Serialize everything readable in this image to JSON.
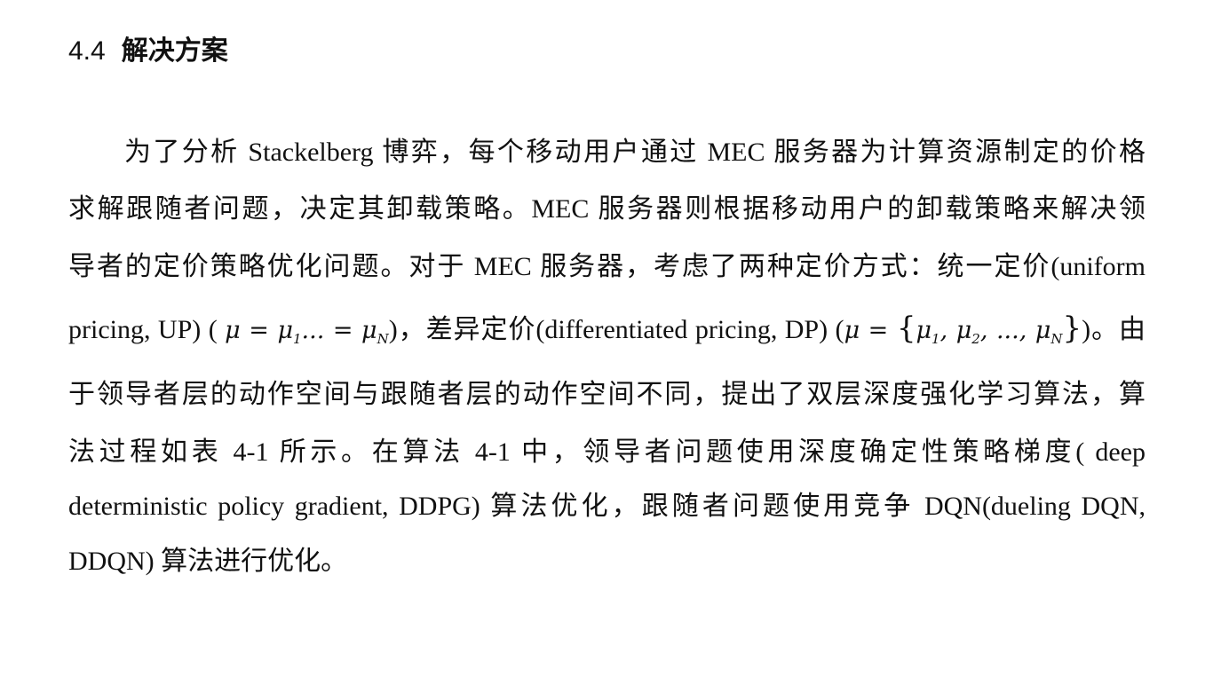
{
  "section": {
    "number": "4.4",
    "title": "解决方案"
  },
  "body": {
    "l1": "为了分析 Stackelberg 博弈，每个移动用户通过 MEC 服务器为计算资源制定的价格",
    "l2": "求解跟随者问题，决定其卸载策略。MEC 服务器则根据移动用户的卸载策略来解决领",
    "l3": "导者的定价策略优化问题。对于 MEC 服务器，考虑了两种定价方式：统一定价(uniform",
    "l4": {
      "a": "pricing, UP) (",
      "b": ")，差异定价(differentiated pricing, DP) (",
      "c": ")。由"
    },
    "l5": "于领导者层的动作空间与跟随者层的动作空间不同，提出了双层深度强化学习算法，算",
    "l6": "法过程如表 4-1 所示。在算法 4-1 中，领导者问题使用深度确定性策略梯度( deep",
    "l7": "deterministic policy gradient, DDPG) 算法优化，跟随者问题使用竞争 DQN(dueling DQN,",
    "l8": "DDQN) 算法进行优化。"
  },
  "math": {
    "mu": "μ",
    "eq": " = ",
    "dots": "...",
    "comma": ", ",
    "ellipsis": "...",
    "sub1": "1",
    "sub2": "2",
    "subN": "N",
    "lbrace": "{",
    "rbrace": "}"
  }
}
